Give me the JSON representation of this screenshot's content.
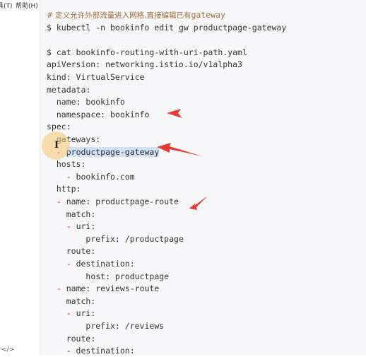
{
  "menubar": {
    "items": [
      "具(T)",
      "帮助(H)"
    ]
  },
  "sidebar": {
    "bottom_icon": "</>"
  },
  "code": {
    "lines": [
      {
        "indent": "",
        "parts": [
          {
            "text": "# 定义允许外部流量进入网格,直接编辑已有",
            "cls": "comment zh"
          },
          {
            "text": "gateway",
            "cls": "comment"
          }
        ]
      },
      {
        "indent": "",
        "parts": [
          {
            "text": "$ kubectl -n bookinfo edit gw productpage-gateway",
            "cls": ""
          }
        ]
      },
      {
        "indent": "",
        "parts": []
      },
      {
        "indent": "",
        "parts": [
          {
            "text": "$ cat bookinfo-routing-with-uri-path.yaml",
            "cls": ""
          }
        ]
      },
      {
        "indent": "",
        "parts": [
          {
            "text": "apiVersion: networking.istio.io/v1alpha3",
            "cls": ""
          }
        ]
      },
      {
        "indent": "",
        "parts": [
          {
            "text": "kind: VirtualService",
            "cls": ""
          }
        ]
      },
      {
        "indent": "",
        "parts": [
          {
            "text": "metadata:",
            "cls": ""
          }
        ]
      },
      {
        "indent": "  ",
        "parts": [
          {
            "text": "name: bookinfo",
            "cls": ""
          }
        ]
      },
      {
        "indent": "  ",
        "parts": [
          {
            "text": "namespace: bookinfo",
            "cls": ""
          }
        ]
      },
      {
        "indent": "",
        "parts": [
          {
            "text": "spec:",
            "cls": ""
          }
        ]
      },
      {
        "indent": "  ",
        "parts": [
          {
            "text": "gateways:",
            "cls": ""
          }
        ]
      },
      {
        "indent": "  ",
        "parts": [
          {
            "text": "- ",
            "cls": "dash"
          },
          {
            "text": "productpage-gateway",
            "cls": "selected"
          }
        ]
      },
      {
        "indent": "  ",
        "parts": [
          {
            "text": "hosts:",
            "cls": ""
          }
        ]
      },
      {
        "indent": "    ",
        "parts": [
          {
            "text": "- bookinfo.com",
            "cls": ""
          }
        ]
      },
      {
        "indent": "  ",
        "parts": [
          {
            "text": "http:",
            "cls": ""
          }
        ]
      },
      {
        "indent": "  ",
        "parts": [
          {
            "text": "- ",
            "cls": "dash"
          },
          {
            "text": "name: productpage-route",
            "cls": ""
          }
        ]
      },
      {
        "indent": "    ",
        "parts": [
          {
            "text": "match:",
            "cls": ""
          }
        ]
      },
      {
        "indent": "    ",
        "parts": [
          {
            "text": "- ",
            "cls": "dash"
          },
          {
            "text": "uri:",
            "cls": ""
          }
        ]
      },
      {
        "indent": "        ",
        "parts": [
          {
            "text": "prefix: /productpage",
            "cls": ""
          }
        ]
      },
      {
        "indent": "    ",
        "parts": [
          {
            "text": "route:",
            "cls": ""
          }
        ]
      },
      {
        "indent": "    ",
        "parts": [
          {
            "text": "- ",
            "cls": "dash"
          },
          {
            "text": "destination:",
            "cls": ""
          }
        ]
      },
      {
        "indent": "        ",
        "parts": [
          {
            "text": "host: productpage",
            "cls": ""
          }
        ]
      },
      {
        "indent": "  ",
        "parts": [
          {
            "text": "- ",
            "cls": "dash"
          },
          {
            "text": "name: reviews-route",
            "cls": ""
          }
        ]
      },
      {
        "indent": "    ",
        "parts": [
          {
            "text": "match:",
            "cls": ""
          }
        ]
      },
      {
        "indent": "    ",
        "parts": [
          {
            "text": "- ",
            "cls": "dash"
          },
          {
            "text": "uri:",
            "cls": ""
          }
        ]
      },
      {
        "indent": "        ",
        "parts": [
          {
            "text": "prefix: /reviews",
            "cls": ""
          }
        ]
      },
      {
        "indent": "    ",
        "parts": [
          {
            "text": "route:",
            "cls": ""
          }
        ]
      },
      {
        "indent": "    ",
        "parts": [
          {
            "text": "- destination:",
            "cls": ""
          }
        ]
      }
    ]
  },
  "cursor": {
    "glyph": "I"
  },
  "colors": {
    "annotation_arrow": "#e53935",
    "comment": "#9a6e3a",
    "selection": "#cfe1f5",
    "cursor_halo": "#f6c66e"
  }
}
